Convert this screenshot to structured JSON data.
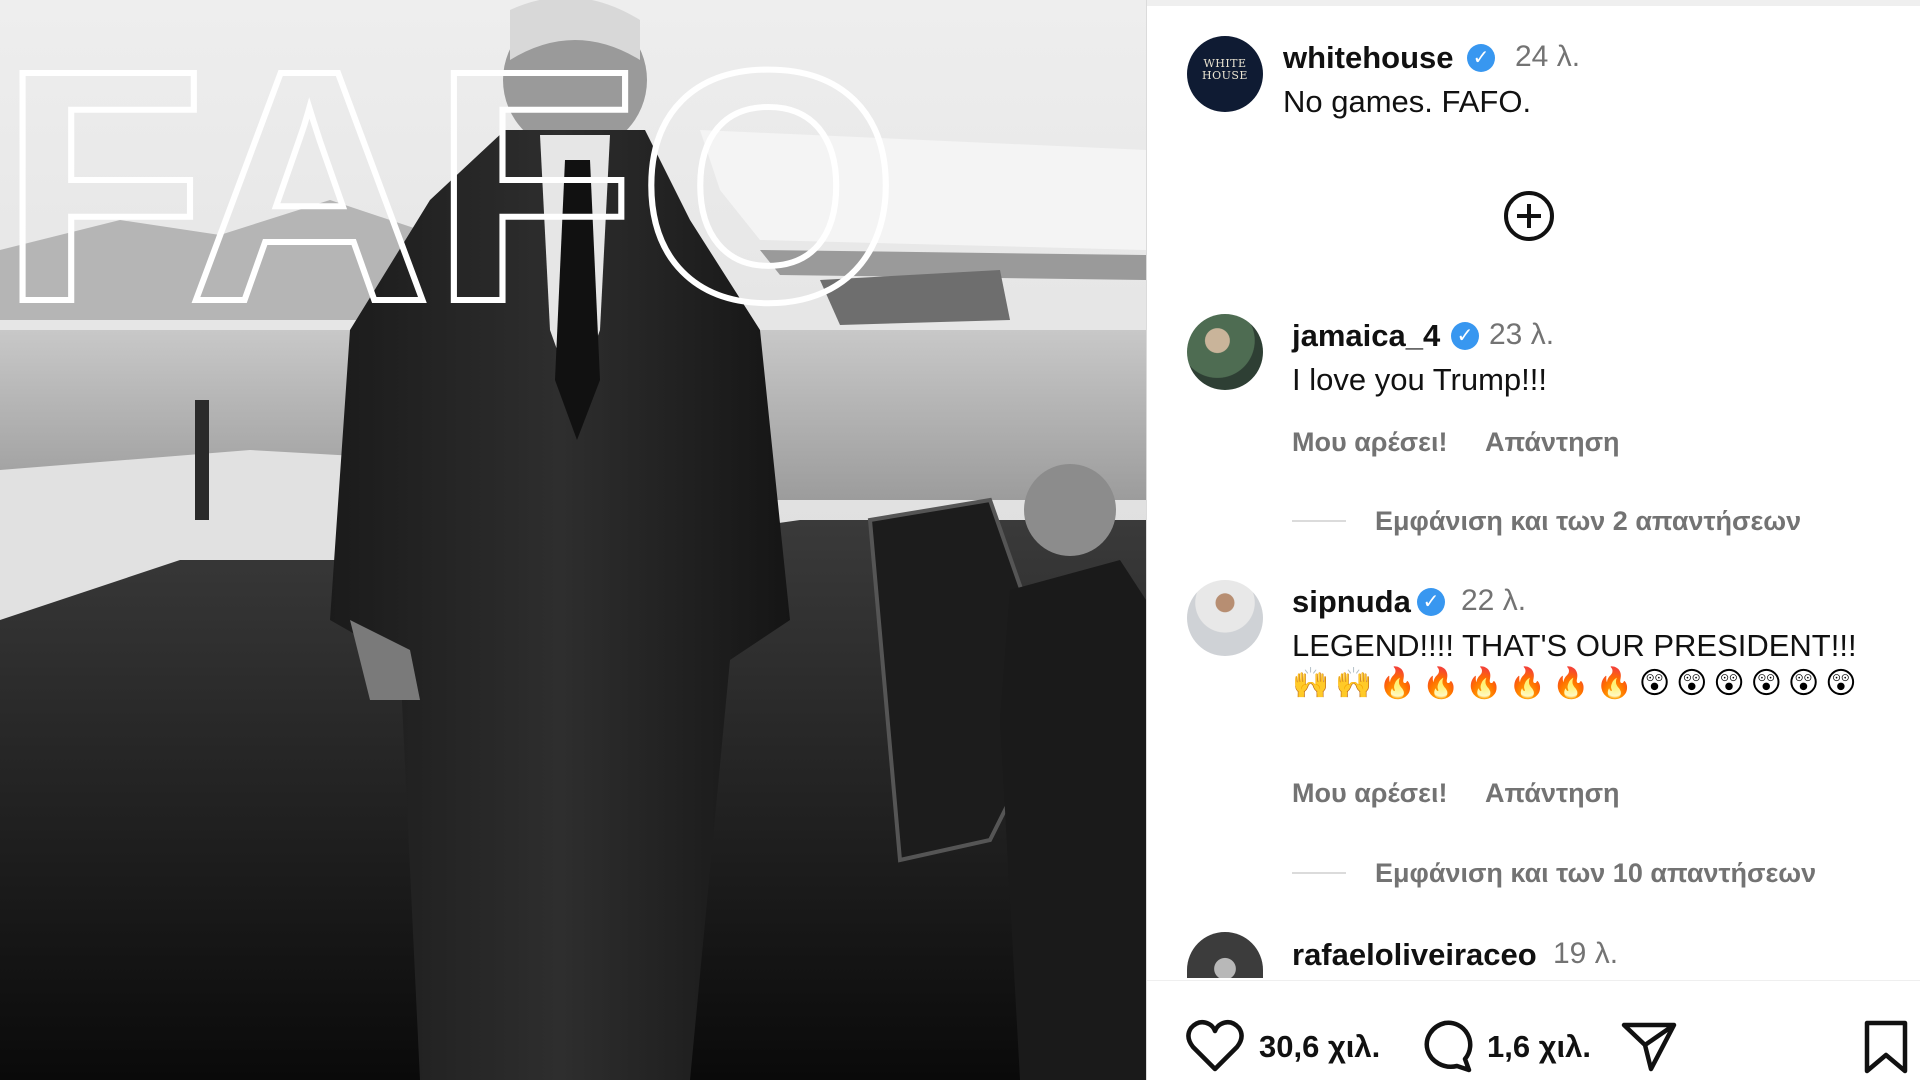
{
  "post": {
    "username": "whitehouse",
    "avatar_text": "WHITE HOUSE",
    "time": "24 λ.",
    "caption": "No games. FAFO.",
    "image_text": "FAFO"
  },
  "comments": [
    {
      "username": "jamaica_4",
      "time": "23 λ.",
      "text": "I love you Trump!!!",
      "like_label": "Μου αρέσει!",
      "reply_label": "Απάντηση",
      "view_replies": "Εμφάνιση και των 2 απαντήσεων"
    },
    {
      "username": "sipnuda",
      "time": "22 λ.",
      "text": "LEGEND!!!! THAT'S OUR PRESIDENT!!!",
      "emojis": "🙌🙌🔥🔥🔥🔥🔥🔥😲😲😲😲😲😲",
      "like_label": "Μου αρέσει!",
      "reply_label": "Απάντηση",
      "view_replies": "Εμφάνιση και των 10 απαντήσεων"
    },
    {
      "username": "rafaeloliveiraceo",
      "time": "19 λ."
    }
  ],
  "actions": {
    "likes": "30,6 χιλ.",
    "comments": "1,6 χιλ.",
    "icons": [
      "heart-icon",
      "comment-icon",
      "share-icon",
      "bookmark-icon"
    ]
  },
  "colors": {
    "verified": "#3897f0",
    "muted": "#737373"
  }
}
